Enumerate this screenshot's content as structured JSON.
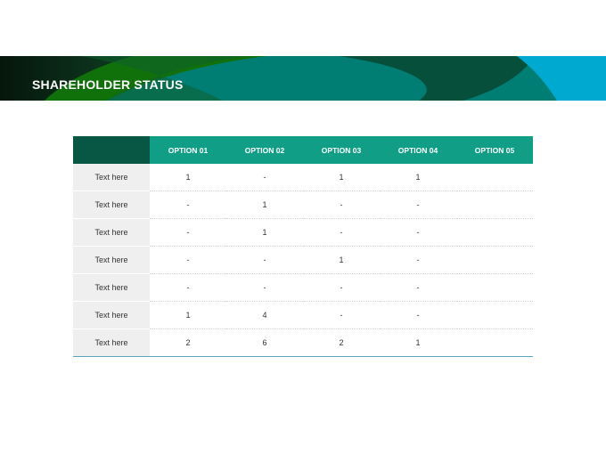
{
  "header": {
    "title": "SHAREHOLDER STATUS"
  },
  "colors": {
    "banner_dark": "#0b2f1a",
    "banner_green": "#10710b",
    "banner_teal": "#007e73",
    "banner_cyan": "#00a9cf",
    "table_header": "#109e86",
    "table_corner": "#075744",
    "row_header_bg": "#efefef"
  },
  "table": {
    "columns": [
      "OPTION 01",
      "OPTION 02",
      "OPTION 03",
      "OPTION 04",
      "OPTION 05"
    ],
    "rows": [
      {
        "label": "Text here",
        "cells": [
          "1",
          "-",
          "1",
          "1",
          ""
        ]
      },
      {
        "label": "Text here",
        "cells": [
          "-",
          "1",
          "-",
          "-",
          ""
        ]
      },
      {
        "label": "Text here",
        "cells": [
          "-",
          "1",
          "-",
          "-",
          ""
        ]
      },
      {
        "label": "Text here",
        "cells": [
          "-",
          "-",
          "1",
          "-",
          ""
        ]
      },
      {
        "label": "Text here",
        "cells": [
          "-",
          "-",
          "-",
          "-",
          ""
        ]
      },
      {
        "label": "Text here",
        "cells": [
          "1",
          "4",
          "-",
          "-",
          ""
        ]
      },
      {
        "label": "Text here",
        "cells": [
          "2",
          "6",
          "2",
          "1",
          ""
        ]
      }
    ]
  }
}
